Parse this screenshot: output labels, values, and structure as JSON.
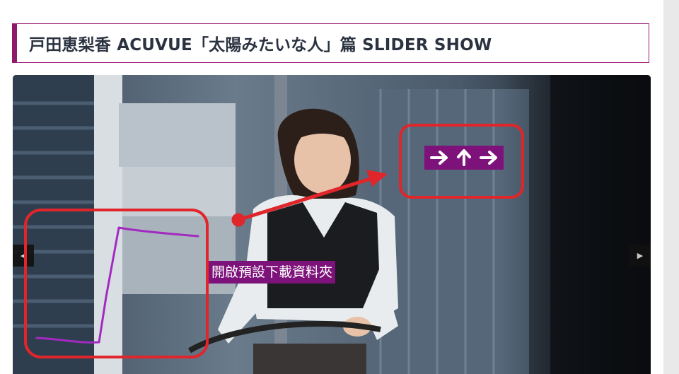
{
  "page": {
    "title": "戸田恵梨香 ACUVUE「太陽みたいな人」篇 SLIDER SHOW"
  },
  "slider": {
    "prev_icon": "chevron-left-icon",
    "next_icon": "chevron-right-icon",
    "prev_glyph": "◀",
    "next_glyph": "▶"
  },
  "annotation": {
    "label": "開啟預設下載資料夾",
    "badge_icons": [
      "arrow-right-icon",
      "arrow-up-icon",
      "arrow-right-icon"
    ],
    "highlight_color": "#e0262b",
    "label_bg": "#7c127a",
    "scribble_color": "#a32ac0"
  },
  "colors": {
    "title_border": "#8d1a6b",
    "title_text": "#2b3340"
  }
}
